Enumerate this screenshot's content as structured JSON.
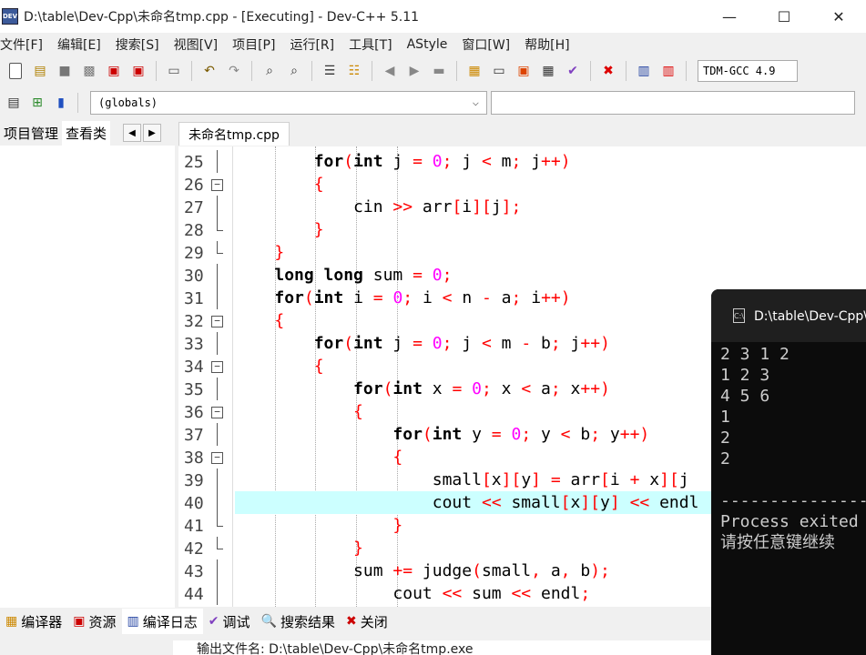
{
  "window": {
    "title": "D:\\table\\Dev-Cpp\\未命名tmp.cpp - [Executing] - Dev-C++ 5.11",
    "app_icon": "DEV",
    "minimize": "—",
    "maximize": "☐",
    "close": "✕"
  },
  "menu": [
    "文件[F]",
    "编辑[E]",
    "搜索[S]",
    "视图[V]",
    "项目[P]",
    "运行[R]",
    "工具[T]",
    "AStyle",
    "窗口[W]",
    "帮助[H]"
  ],
  "toolbar": {
    "compiler": "TDM-GCC 4.9"
  },
  "toolbar2": {
    "scope": "(globals)",
    "function": ""
  },
  "left_panel": {
    "tabs": [
      "项目管理",
      "查看类"
    ],
    "prev": "◀",
    "next": "▶"
  },
  "editor": {
    "file_tab": "未命名tmp.cpp",
    "highlighted_line": 40,
    "lines": [
      {
        "n": "25",
        "fold": "mid"
      },
      {
        "n": "26",
        "fold": "open"
      },
      {
        "n": "27",
        "fold": "mid"
      },
      {
        "n": "28",
        "fold": "end"
      },
      {
        "n": "29",
        "fold": "end"
      },
      {
        "n": "30",
        "fold": "mid"
      },
      {
        "n": "31",
        "fold": "mid"
      },
      {
        "n": "32",
        "fold": "open"
      },
      {
        "n": "33",
        "fold": "mid"
      },
      {
        "n": "34",
        "fold": "open"
      },
      {
        "n": "35",
        "fold": "mid"
      },
      {
        "n": "36",
        "fold": "open"
      },
      {
        "n": "37",
        "fold": "mid"
      },
      {
        "n": "38",
        "fold": "open"
      },
      {
        "n": "39",
        "fold": "mid"
      },
      {
        "n": "40",
        "fold": "mid"
      },
      {
        "n": "41",
        "fold": "end"
      },
      {
        "n": "42",
        "fold": "end"
      },
      {
        "n": "43",
        "fold": "mid"
      },
      {
        "n": "44",
        "fold": "mid"
      }
    ],
    "code": [
      [
        [
          "",
          "        "
        ],
        [
          "kw",
          "for"
        ],
        [
          "op",
          "("
        ],
        [
          "kw",
          "int"
        ],
        [
          "",
          " j "
        ],
        [
          "op",
          "="
        ],
        [
          "",
          " "
        ],
        [
          "num-lit",
          "0"
        ],
        [
          "op",
          ";"
        ],
        [
          "",
          " j "
        ],
        [
          "op",
          "<"
        ],
        [
          "",
          " m"
        ],
        [
          "op",
          ";"
        ],
        [
          "",
          " j"
        ],
        [
          "op",
          "++)"
        ]
      ],
      [
        [
          "",
          "        "
        ],
        [
          "op",
          "{"
        ]
      ],
      [
        [
          "",
          "            cin "
        ],
        [
          "op",
          ">>"
        ],
        [
          "",
          " arr"
        ],
        [
          "op",
          "["
        ],
        [
          "",
          "i"
        ],
        [
          "op",
          "]["
        ],
        [
          "",
          "j"
        ],
        [
          "op",
          "];"
        ]
      ],
      [
        [
          "",
          "        "
        ],
        [
          "op",
          "}"
        ]
      ],
      [
        [
          "",
          "    "
        ],
        [
          "op",
          "}"
        ]
      ],
      [
        [
          "",
          "    "
        ],
        [
          "kw",
          "long long"
        ],
        [
          "",
          " sum "
        ],
        [
          "op",
          "="
        ],
        [
          "",
          " "
        ],
        [
          "num-lit",
          "0"
        ],
        [
          "op",
          ";"
        ]
      ],
      [
        [
          "",
          "    "
        ],
        [
          "kw",
          "for"
        ],
        [
          "op",
          "("
        ],
        [
          "kw",
          "int"
        ],
        [
          "",
          " i "
        ],
        [
          "op",
          "="
        ],
        [
          "",
          " "
        ],
        [
          "num-lit",
          "0"
        ],
        [
          "op",
          ";"
        ],
        [
          "",
          " i "
        ],
        [
          "op",
          "<"
        ],
        [
          "",
          " n "
        ],
        [
          "op",
          "-"
        ],
        [
          "",
          " a"
        ],
        [
          "op",
          ";"
        ],
        [
          "",
          " i"
        ],
        [
          "op",
          "++)"
        ]
      ],
      [
        [
          "",
          "    "
        ],
        [
          "op",
          "{"
        ]
      ],
      [
        [
          "",
          "        "
        ],
        [
          "kw",
          "for"
        ],
        [
          "op",
          "("
        ],
        [
          "kw",
          "int"
        ],
        [
          "",
          " j "
        ],
        [
          "op",
          "="
        ],
        [
          "",
          " "
        ],
        [
          "num-lit",
          "0"
        ],
        [
          "op",
          ";"
        ],
        [
          "",
          " j "
        ],
        [
          "op",
          "<"
        ],
        [
          "",
          " m "
        ],
        [
          "op",
          "-"
        ],
        [
          "",
          " b"
        ],
        [
          "op",
          ";"
        ],
        [
          "",
          " j"
        ],
        [
          "op",
          "++)"
        ]
      ],
      [
        [
          "",
          "        "
        ],
        [
          "op",
          "{"
        ]
      ],
      [
        [
          "",
          "            "
        ],
        [
          "kw",
          "for"
        ],
        [
          "op",
          "("
        ],
        [
          "kw",
          "int"
        ],
        [
          "",
          " x "
        ],
        [
          "op",
          "="
        ],
        [
          "",
          " "
        ],
        [
          "num-lit",
          "0"
        ],
        [
          "op",
          ";"
        ],
        [
          "",
          " x "
        ],
        [
          "op",
          "<"
        ],
        [
          "",
          " a"
        ],
        [
          "op",
          ";"
        ],
        [
          "",
          " x"
        ],
        [
          "op",
          "++)"
        ]
      ],
      [
        [
          "",
          "            "
        ],
        [
          "op",
          "{"
        ]
      ],
      [
        [
          "",
          "                "
        ],
        [
          "kw",
          "for"
        ],
        [
          "op",
          "("
        ],
        [
          "kw",
          "int"
        ],
        [
          "",
          " y "
        ],
        [
          "op",
          "="
        ],
        [
          "",
          " "
        ],
        [
          "num-lit",
          "0"
        ],
        [
          "op",
          ";"
        ],
        [
          "",
          " y "
        ],
        [
          "op",
          "<"
        ],
        [
          "",
          " b"
        ],
        [
          "op",
          ";"
        ],
        [
          "",
          " y"
        ],
        [
          "op",
          "++)"
        ]
      ],
      [
        [
          "",
          "                "
        ],
        [
          "op",
          "{"
        ]
      ],
      [
        [
          "",
          "                    small"
        ],
        [
          "op",
          "["
        ],
        [
          "",
          "x"
        ],
        [
          "op",
          "]["
        ],
        [
          "",
          "y"
        ],
        [
          "op",
          "]"
        ],
        [
          "",
          " "
        ],
        [
          "op",
          "="
        ],
        [
          "",
          " arr"
        ],
        [
          "op",
          "["
        ],
        [
          "",
          "i "
        ],
        [
          "op",
          "+"
        ],
        [
          "",
          " x"
        ],
        [
          "op",
          "]["
        ],
        [
          "",
          "j"
        ]
      ],
      [
        [
          "",
          "                    cout "
        ],
        [
          "op",
          "<<"
        ],
        [
          "",
          " small"
        ],
        [
          "op",
          "["
        ],
        [
          "",
          "x"
        ],
        [
          "op",
          "]["
        ],
        [
          "",
          "y"
        ],
        [
          "op",
          "]"
        ],
        [
          "",
          " "
        ],
        [
          "op",
          "<<"
        ],
        [
          "",
          " endl"
        ]
      ],
      [
        [
          "",
          "                "
        ],
        [
          "op",
          "}"
        ]
      ],
      [
        [
          "",
          "            "
        ],
        [
          "op",
          "}"
        ]
      ],
      [
        [
          "",
          "            sum "
        ],
        [
          "op",
          "+="
        ],
        [
          "",
          " judge"
        ],
        [
          "op",
          "("
        ],
        [
          "",
          "small"
        ],
        [
          "op",
          ","
        ],
        [
          "",
          " a"
        ],
        [
          "op",
          ","
        ],
        [
          "",
          " b"
        ],
        [
          "op",
          ");"
        ]
      ],
      [
        [
          "",
          "                cout "
        ],
        [
          "op",
          "<<"
        ],
        [
          "",
          " sum "
        ],
        [
          "op",
          "<<"
        ],
        [
          "",
          " endl"
        ],
        [
          "op",
          ";"
        ]
      ]
    ]
  },
  "bottom": {
    "tabs": [
      {
        "icon": "▦",
        "label": "编译器"
      },
      {
        "icon": "▣",
        "label": "资源"
      },
      {
        "icon": "▥",
        "label": "编译日志"
      },
      {
        "icon": "✔",
        "label": "调试"
      },
      {
        "icon": "🔍",
        "label": "搜索结果"
      },
      {
        "icon": "✖",
        "label": "关闭"
      }
    ],
    "output_line": "输出文件名: D:\\table\\Dev-Cpp\\未命名tmp.exe"
  },
  "console": {
    "title": "D:\\table\\Dev-Cpp\\未命名tmp.exe",
    "icon": "C:\\",
    "lines": [
      "2 3 1 2",
      "1 2 3",
      "4 5 6",
      "1",
      "2",
      "2",
      "",
      "--------------------------------",
      "Process exited",
      "请按任意键继续"
    ]
  },
  "colors": {
    "keyword": "#000000",
    "operator": "#ff0000",
    "number": "#ff00ff",
    "current_line": "#ccffff",
    "console_bg": "#0c0c0c",
    "console_fg": "#cccccc"
  }
}
